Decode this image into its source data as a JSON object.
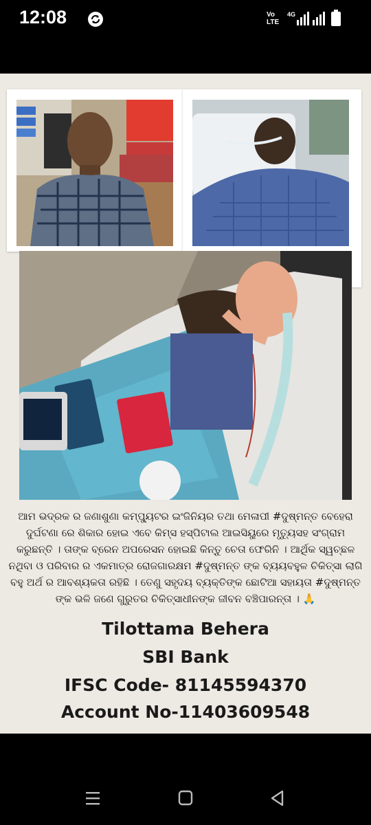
{
  "status_bar": {
    "time": "12:08",
    "volte_top": "Vo",
    "volte_bottom": "LTE",
    "network": "4G"
  },
  "post": {
    "caption": "ଆମ ଭଦ୍ରକ ର ଜଣାଶୁଣା କମ୍ପ୍ୟୁଟର ଇଂଜିନିୟର ତଥା ମେଳାପୀ #ଦୁଷ୍ମନ୍ତ ବେହେରା ଦୁର୍ଘଟଣା ରେ ଶିକାର ହୋଇ ଏବେ କିମ୍ସ ହସ୍ପିଟାଲ ଆଇସିୟୁରେ ମୃତ୍ୟୁସହ ସଂଗ୍ରାମ କରୁଛନ୍ତି । ତାଙ୍କ ବ୍ରେନ ଅପରେସନ ହୋଇଛି କିନ୍ତୁ ଚେତା ଫେରିନି ।  ଆର୍ଥିକ ସ୍ୱଚ୍ଛଳ ନଥିବା ଓ ପରିବାର ର ଏକମାତ୍ର ରୋଜଗାରକ୍ଷମ #ଦୁଷ୍ମନ୍ତ ଙ୍କ ବ୍ୟୟବହୁଳ ଚିକିତ୍ସା ଲାଗି ବହୁ ଅର୍ଥ ର ଆବଶ୍ୟକତା ରହିଛି । ତେଣୁ ସହୃଦୟ ବ୍ୟକ୍ତିଙ୍କ ଛୋଟିଆ ସହାୟତା #ଦୁଷ୍ମନ୍ତ ଙ୍କ ଭଳି ଜଣେ ଗୁରୁତର ଚିକିତ୍ସାଧୀନଙ୍କ ଜୀବନ ବଞ୍ଚିପାରନ୍ତା । 🙏",
    "bank": {
      "name": "Tilottama Behera",
      "bank_name": "SBI Bank",
      "ifsc": "IFSC Code- 81145594370",
      "account": "Account No-11403609548"
    }
  },
  "colors": {
    "viewer_bg": "#ede9e3",
    "status_bg": "#000000"
  },
  "icons": [
    "sync-icon",
    "signal-icon",
    "battery-icon",
    "recents-icon",
    "home-icon",
    "back-icon"
  ]
}
